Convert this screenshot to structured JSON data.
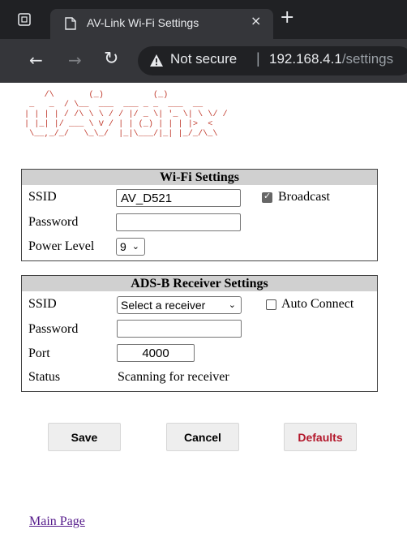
{
  "browser": {
    "tab_title": "AV-Link Wi-Fi Settings",
    "tab_close_glyph": "×",
    "new_tab_glyph": "+",
    "security_label": "Not secure",
    "url_host": "192.168.4.1",
    "url_path": "/settings"
  },
  "logo": {
    "art_red_lines": [
      "    /\\       (_)          (_)              ",
      " _   _  / \\__  ___  ___ _ _  ___  __        ",
      "| | | | / /\\ \\ \\ / / |/ _ \\| '_ \\| \\ \\/ /  ",
      "| |_| |/ ___ \\ V / | | (_) | | | |>  <       ",
      " \\__,_/_/   \\_\\_/  |_|\\___/|_| |_/_/\\_\\     "
    ]
  },
  "wifi": {
    "title": "Wi-Fi Settings",
    "ssid_label": "SSID",
    "ssid_value": "AV_D521",
    "broadcast_label": "Broadcast",
    "broadcast_checked": true,
    "password_label": "Password",
    "password_value": "",
    "power_label": "Power Level",
    "power_value": "9"
  },
  "adsb": {
    "title": "ADS-B Receiver Settings",
    "ssid_label": "SSID",
    "ssid_selected": "Select a receiver",
    "auto_connect_label": "Auto Connect",
    "auto_connect_checked": false,
    "password_label": "Password",
    "password_value": "",
    "port_label": "Port",
    "port_value": "4000",
    "status_label": "Status",
    "status_value": "Scanning for receiver"
  },
  "buttons": {
    "save": "Save",
    "cancel": "Cancel",
    "defaults": "Defaults"
  },
  "footer": {
    "main_page_link": "Main Page"
  },
  "colors": {
    "chrome_dark": "#202124",
    "chrome_mid": "#35363a",
    "panel_header": "#d0d0d0",
    "defaults_text": "#b3172b",
    "ascii_red": "#c0392b",
    "ascii_blue": "#1f4e9c",
    "link": "#551a8b"
  }
}
